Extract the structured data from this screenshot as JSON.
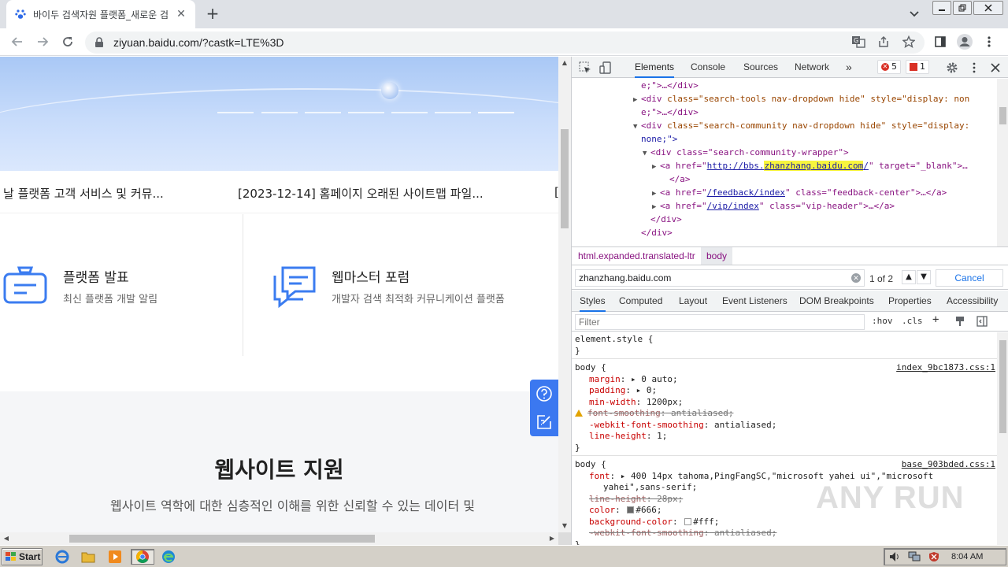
{
  "browser": {
    "tab_title": "바이두 검색자원 플랫폼_새로운 검",
    "url": "ziyuan.baidu.com/?castk=LTE%3D"
  },
  "page": {
    "news": [
      "날 플랫폼 고객 서비스 및 커뮤...",
      "[2023-12-14] 홈페이지 오래된 사이트맵 파일...",
      "["
    ],
    "cards": [
      {
        "title": "플랫폼 발표",
        "desc": "최신 플랫폼 개발 알림",
        "icon": "announcement-icon"
      },
      {
        "title": "웹마스터 포럼",
        "desc": "개발자 검색 최적화 커뮤니케이션 플랫폼",
        "icon": "forum-chat-icon"
      }
    ],
    "support_title": "웹사이트 지원",
    "support_desc": "웹사이트 역학에 대한 심층적인 이해를 위한 신뢰할 수 있는 데이터 및"
  },
  "devtools": {
    "tabs": [
      "Elements",
      "Console",
      "Sources",
      "Network"
    ],
    "more": "»",
    "errors": "5",
    "issues": "1",
    "dom_lines": {
      "l1": "e;\">…</div>",
      "l2_tag": "<div ",
      "l2_attr": "class=\"search-tools nav-dropdown hide\" style=\"display: non",
      "l3": "e;\">…</div>",
      "l4_tag": "<div ",
      "l4_attr": "class=\"search-community nav-dropdown hide\" style=\"display:",
      "l5": "none;\">",
      "l6": "<div class=\"search-community-wrapper\">",
      "l7_pre": "<a href=\"",
      "l7_link_a": "http://bbs.",
      "l7_link_hl": "zhanzhang.baidu.com",
      "l7_link_b": "/",
      "l7_post": "\" target=\"_blank\">…",
      "l8": "</a>",
      "l9_pre": "<a href=\"",
      "l9_link": "/feedback/index",
      "l9_post": "\" class=\"feedback-center\">…</a>",
      "l10_pre": "<a href=\"",
      "l10_link": "/vip/index",
      "l10_post": "\" class=\"vip-header\">…</a>",
      "l11": "</div>",
      "l12": "</div>"
    },
    "breadcrumb": [
      "html.expanded.translated-ltr",
      "body"
    ],
    "search_value": "zhanzhang.baidu.com",
    "search_count": "1 of 2",
    "cancel": "Cancel",
    "subtabs": [
      "Styles",
      "Computed",
      "Layout",
      "Event Listeners",
      "DOM Breakpoints",
      "Properties",
      "Accessibility"
    ],
    "filter_placeholder": "Filter",
    "hov": ":hov",
    "cls": ".cls",
    "styles": {
      "element_style": "element.style {",
      "close": "}",
      "r1_sel": "body {",
      "r1_src": "index_9bc1873.css:1",
      "r1_p1": "margin",
      "r1_v1": "▸ 0 auto;",
      "r1_p2": "padding",
      "r1_v2": "▸ 0;",
      "r1_p3": "min-width",
      "r1_v3": " 1200px;",
      "r1_p4": "font-smoothing",
      "r1_v4": " antialiased;",
      "r1_p5": "-webkit-font-smoothing",
      "r1_v5": " antialiased;",
      "r1_p6": "line-height",
      "r1_v6": " 1;",
      "r2_sel": "body {",
      "r2_src": "base_903bded.css:1",
      "r2_p1": "font",
      "r2_v1": "▸ 400 14px tahoma,PingFangSC,\"microsoft yahei ui\",\"microsoft",
      "r2_v1b": "yahei\",sans-serif;",
      "r2_p2": "line-height",
      "r2_v2": " 28px;",
      "r2_p3": "color",
      "r2_v3": "#666;",
      "r2_p4": "background-color",
      "r2_v4": "#fff;",
      "r2_p5": "-webkit-font-smoothing",
      "r2_v5": " antialiased;",
      "r2_close": "}"
    }
  },
  "watermark": "ANY RUN",
  "taskbar": {
    "start": "Start",
    "clock": "8:04 AM"
  },
  "colors": {
    "accent": "#1a73e8",
    "float_bar": "#3b78f0",
    "icon_blue": "#3b7cf0"
  }
}
